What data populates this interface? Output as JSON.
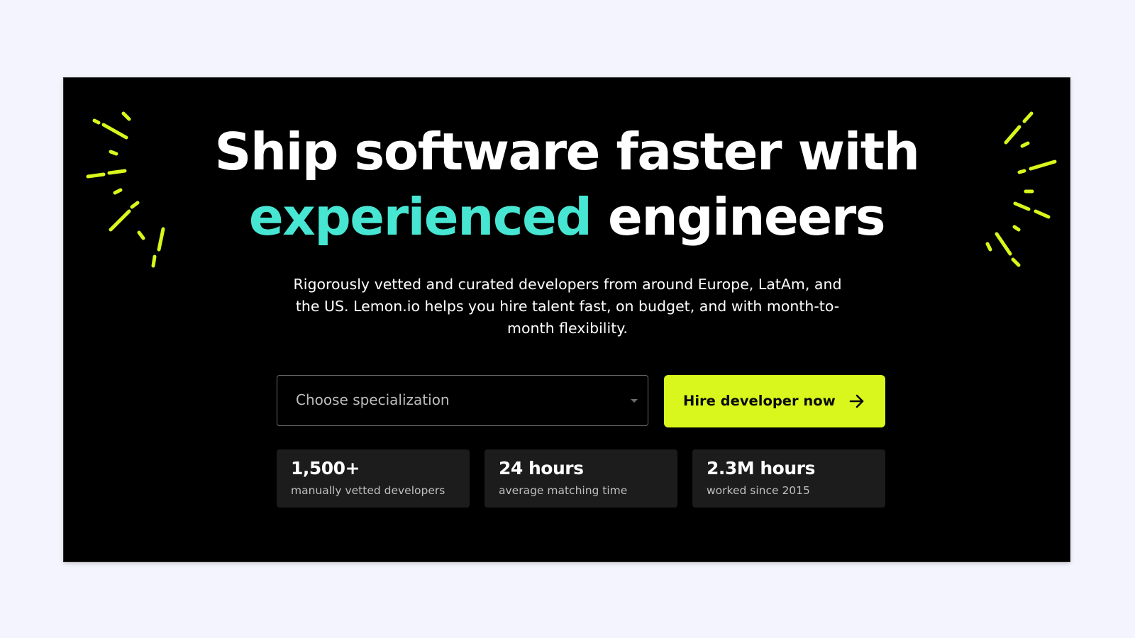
{
  "colors": {
    "background": "#f3f4fd",
    "panel": "#000000",
    "accent_teal": "#47e6d3",
    "accent_lime": "#d9f71c",
    "stat_card": "#1c1c1c"
  },
  "hero": {
    "headline_line1": "Ship software faster with",
    "headline_accent": "experienced",
    "headline_rest": "engineers",
    "subtitle": "Rigorously vetted and curated developers from around Europe, LatAm, and the US. Lemon.io helps you hire talent fast, on budget, and with month-to-month flexibility."
  },
  "form": {
    "specialization_placeholder": "Choose specialization",
    "dropdown_icon": "chevron-down-icon",
    "cta_label": "Hire developer now",
    "cta_icon": "arrow-right-icon"
  },
  "stats": [
    {
      "value": "1,500+",
      "caption": "manually vetted developers"
    },
    {
      "value": "24 hours",
      "caption": "average matching time"
    },
    {
      "value": "2.3M hours",
      "caption": "worked since 2015"
    }
  ],
  "decorations": {
    "left_icon": "burst-lines-icon",
    "right_icon": "burst-lines-icon"
  }
}
